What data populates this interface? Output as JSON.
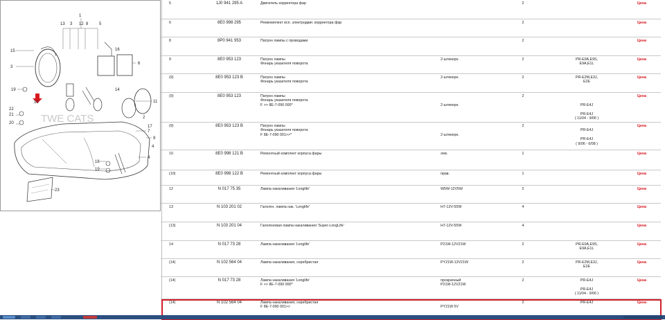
{
  "diagram": {
    "labels": [
      "1",
      "13",
      "3",
      "12",
      "8",
      "5",
      "15",
      "3",
      "19",
      "10",
      "21",
      "22",
      "20",
      "14",
      "16",
      "6",
      "11",
      "7",
      "9",
      "17",
      "4",
      "18",
      "19",
      "23",
      "2",
      "4"
    ],
    "watermark": "TWE CATS"
  },
  "parts_table": {
    "rows": [
      {
        "pos": "5",
        "part_number": "1J0 941 295 A",
        "name": [
          "Двигатель корректора фар"
        ],
        "note": [],
        "qty": "2",
        "code": [],
        "price": "Цена"
      },
      {
        "pos": "6",
        "part_number": "8E0 998 295",
        "name": [
          "Ремкомплект исп. электродвиг. корректора фар"
        ],
        "note": [],
        "qty": "2",
        "code": [],
        "price": "Цена"
      },
      {
        "pos": "8",
        "part_number": "8P0 941 953",
        "name": [
          "Патрон лампы с проводами"
        ],
        "note": [],
        "qty": "2",
        "code": [],
        "price": "Цена"
      },
      {
        "pos": "9",
        "part_number": "8E0 953 123",
        "name": [
          "Патрон лампы",
          "Фонарь указателя поворота"
        ],
        "note": [
          "2-штекерн."
        ],
        "qty": "2",
        "code": [
          "PR-E0A,E9S,",
          "E9A,E1L"
        ],
        "price": "Цена"
      },
      {
        "pos": "(9)",
        "part_number": "8E0 953 123 B",
        "name": [
          "Патрон лампы",
          "Фонарь указателя поворота"
        ],
        "note": [
          "2-штекерн."
        ],
        "qty": "2",
        "code": [
          "PR-E2M,E3J,",
          "E2E"
        ],
        "price": "Цена"
      },
      {
        "pos": "(9)",
        "part_number": "8E0 953 123",
        "name": [
          "Патрон лампы",
          "Фонарь указателя поворота",
          "F >> 8E-7-090 000*"
        ],
        "note": [
          "",
          "",
          "2-штекерн."
        ],
        "qty": "2",
        "code": [
          "",
          "",
          "PR-E4J",
          "",
          "PR-E4J",
          "( 11/04 - 9/06 )"
        ],
        "price": "Цена"
      },
      {
        "pos": "(9)",
        "part_number": "8E0 953 123 B",
        "name": [
          "Патрон лампы",
          "Фонарь указателя поворота",
          "F 8E-7-090 001>>*"
        ],
        "note": [
          "",
          "",
          "2-штекерн."
        ],
        "qty": "2",
        "code": [
          "",
          "PR-E4J",
          "",
          "PR-E4J",
          "( 9/06 - 6/08 )"
        ],
        "price": "Цена"
      },
      {
        "pos": "10",
        "part_number": "8E0 998 121 B",
        "name": [
          "Ремонтный комплект корпуса фары"
        ],
        "note": [
          "лев."
        ],
        "qty": "1",
        "code": [],
        "price": "Цена"
      },
      {
        "pos": "(10)",
        "part_number": "8E0 998 122 B",
        "name": [
          "Ремонтный комплект корпуса фары"
        ],
        "note": [
          "прав."
        ],
        "qty": "1",
        "code": [],
        "price": "Цена"
      },
      {
        "pos": "12",
        "part_number": "N 017 75 35",
        "name": [
          "Лампа накаливания 'Longlife'"
        ],
        "note": [
          "W5W-12V5W"
        ],
        "qty": "2",
        "code": [],
        "price": "Цена"
      },
      {
        "pos": "13",
        "part_number": "N 103 201 02",
        "name": [
          "Галоген. лампа нак. 'Longlife'"
        ],
        "note": [
          "H7-12V-55W"
        ],
        "qty": "4",
        "code": [],
        "price": "Цена"
      },
      {
        "pos": "(13)",
        "part_number": "N 103 201 04",
        "name": [
          "Галогеновая лампа накаливания 'Super-LongLife'"
        ],
        "note": [
          "H7-12V-55W"
        ],
        "qty": "4",
        "code": [],
        "price": "Цена"
      },
      {
        "pos": "14",
        "part_number": "N 017 73 28",
        "name": [
          "Лампа накаливания 'Longlife'"
        ],
        "note": [
          "P21W-12V21W"
        ],
        "qty": "2",
        "code": [
          "PR-E0A,E9S,",
          "E9A,E1L"
        ],
        "price": "Цена"
      },
      {
        "pos": "(14)",
        "part_number": "N 102 564 04",
        "name": [
          "Лампа накаливания, серебристая"
        ],
        "note": [
          "PY21W-12V21W"
        ],
        "qty": "2",
        "code": [
          "PR-E2M,E3J,",
          "E2E"
        ],
        "price": "Цена"
      },
      {
        "pos": "(14)",
        "part_number": "N 017 73 28",
        "name": [
          "Лампа накаливания 'Longlife'",
          "F >> 8E-7-090 000*"
        ],
        "note": [
          "прозрачный",
          "P21W-12V21W"
        ],
        "qty": "2",
        "code": [
          "PR-E4J",
          "",
          "PR-E4J",
          "( 11/04 - 9/06 )"
        ],
        "price": "Цена"
      },
      {
        "pos": "(14)",
        "part_number": "N 102 564 04",
        "name": [
          "Лампа накаливания, серебристая",
          "F 8E-7-090 001>>"
        ],
        "note": [
          "",
          "PY21W 5V"
        ],
        "qty": "2",
        "code": [
          "PR-E4J"
        ],
        "price": "Цена"
      }
    ]
  },
  "colors": {
    "highlight_border": "#cf1f2a",
    "price": "#d71920",
    "taskbar": "#2b4f7f"
  }
}
